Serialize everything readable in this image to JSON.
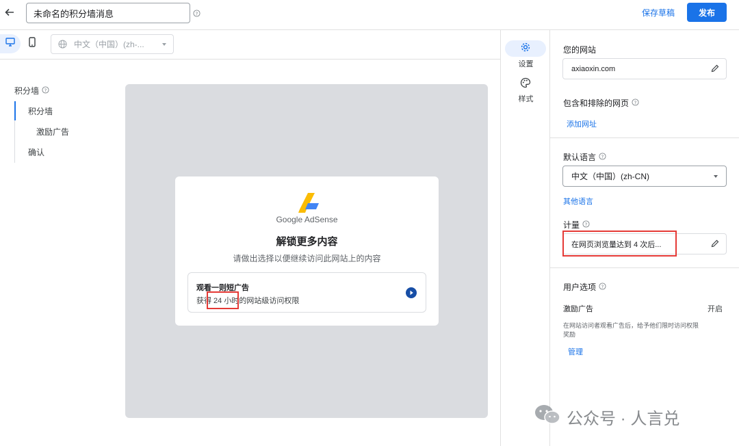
{
  "header": {
    "title_value": "未命名的积分墙消息",
    "save_draft_label": "保存草稿",
    "publish_label": "发布"
  },
  "device_bar": {
    "language_value": "中文（中国）(zh-..."
  },
  "left_nav": {
    "heading": "积分墙",
    "items": [
      "积分墙",
      "激励广告",
      "确认"
    ]
  },
  "preview": {
    "logo_text": "Google AdSense",
    "title": "解锁更多内容",
    "subtitle": "请做出选择以便继续访问此网站上的内容",
    "option_title": "观看一则短广告",
    "option_desc": "获得 24 小时的网站级访问权限"
  },
  "rail": {
    "settings_label": "设置",
    "style_label": "样式"
  },
  "panel": {
    "site_label": "您的网站",
    "site_value": "axiaoxin.com",
    "pages_label": "包含和排除的网页",
    "add_url_label": "添加网址",
    "default_lang_label": "默认语言",
    "default_lang_value": "中文（中国）(zh-CN)",
    "other_lang_label": "其他语言",
    "measure_label": "计量",
    "measure_value": "在网页浏览量达到 4 次后...",
    "user_options_label": "用户选项",
    "rewarded_label": "激励广告",
    "rewarded_status": "开启",
    "rewarded_desc": "在网站访问者观看广告后，给予他们限时访问权限奖励",
    "manage_label": "管理"
  },
  "watermark": {
    "text": "公众号 · 人言兑"
  },
  "colors": {
    "accent": "#1a73e8",
    "highlight_box": "#e53935"
  }
}
